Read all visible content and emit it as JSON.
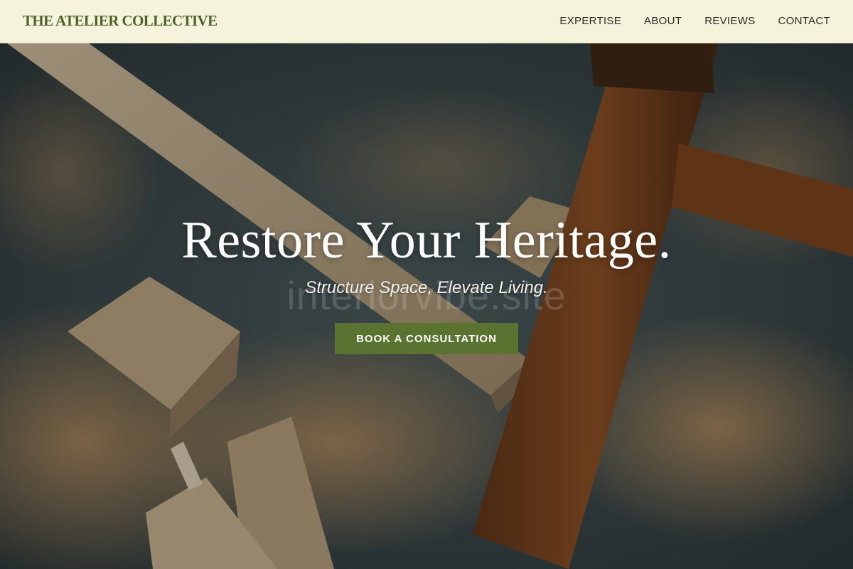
{
  "header": {
    "logo": "THE ATELIER COLLECTIVE",
    "nav": [
      {
        "label": "EXPERTISE"
      },
      {
        "label": "ABOUT"
      },
      {
        "label": "REVIEWS"
      },
      {
        "label": "CONTACT"
      }
    ]
  },
  "hero": {
    "title": "Restore Your Heritage.",
    "tagline": "Structure Space, Elevate Living.",
    "watermark": "interiorvibe.site",
    "cta_label": "BOOK A CONSULTATION",
    "background_image": "sawdust-wood-planks-photo"
  },
  "colors": {
    "header_bg": "#f6f3dc",
    "logo": "#4f6128",
    "cta_bg": "#5b7331",
    "hero_text": "#ffffff"
  }
}
